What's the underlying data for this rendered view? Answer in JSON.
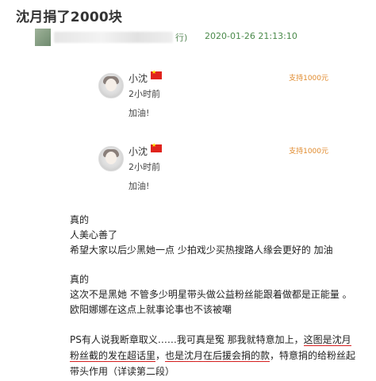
{
  "title": "沈月捐了2000块",
  "meta": {
    "paren": "行)",
    "time": "2020-01-26 21:13:10"
  },
  "cards": [
    {
      "name": "小沈",
      "time_ago": "2小时前",
      "comment": "加油!",
      "support": "支持1000元"
    },
    {
      "name": "小沈",
      "time_ago": "2小时前",
      "comment": "加油!",
      "support": "支持1000元"
    }
  ],
  "paragraphs": {
    "p1": [
      "真的",
      "人美心善了",
      "希望大家以后少黑她一点   少拍戏少买热搜路人缘会更好的 加油"
    ],
    "p2": [
      "真的",
      "这次不是黑她  不管多少明星带头做公益粉丝能跟着做都是正能量 。",
      "欧阳娜娜在这点上就事论事也不该被嘲"
    ],
    "p3": {
      "line1_a": "PS有人说我断章取义……我可真是冤 那我就特意加上，",
      "line1_b": "这图是沈月",
      "line2_a": "粉丝截的发在超话里",
      "line2_b": "，",
      "line2_c": "也是沈月在后援会捐的款",
      "line2_d": "，特意捐的给粉丝起",
      "line3": "带头作用（详读第二段）"
    }
  },
  "colors": {
    "support": "#e08a2c",
    "time": "#4a8a4a",
    "underline": "#d62020",
    "flag": "#e0231c"
  }
}
